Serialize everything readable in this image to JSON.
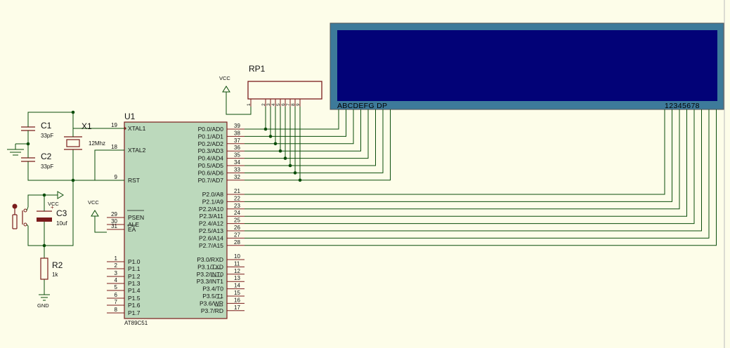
{
  "components": {
    "u1": {
      "ref": "U1",
      "part": "AT89C51",
      "left_pins": [
        {
          "num": "19",
          "name": "XTAL1"
        },
        {
          "num": "18",
          "name": "XTAL2"
        },
        {
          "num": "9",
          "name": "RST"
        },
        {
          "num": "29",
          "name": "PSEN"
        },
        {
          "num": "30",
          "name": "ALE"
        },
        {
          "num": "31",
          "name": "EA"
        },
        {
          "num": "1",
          "name": "P1.0"
        },
        {
          "num": "2",
          "name": "P1.1"
        },
        {
          "num": "3",
          "name": "P1.2"
        },
        {
          "num": "4",
          "name": "P1.3"
        },
        {
          "num": "5",
          "name": "P1.4"
        },
        {
          "num": "6",
          "name": "P1.5"
        },
        {
          "num": "7",
          "name": "P1.6"
        },
        {
          "num": "8",
          "name": "P1.7"
        }
      ],
      "right_pins": [
        {
          "num": "39",
          "name": "P0.0/AD0"
        },
        {
          "num": "38",
          "name": "P0.1/AD1"
        },
        {
          "num": "37",
          "name": "P0.2/AD2"
        },
        {
          "num": "36",
          "name": "P0.3/AD3"
        },
        {
          "num": "35",
          "name": "P0.4/AD4"
        },
        {
          "num": "34",
          "name": "P0.5/AD5"
        },
        {
          "num": "33",
          "name": "P0.6/AD6"
        },
        {
          "num": "32",
          "name": "P0.7/AD7"
        },
        {
          "num": "21",
          "name": "P2.0/A8"
        },
        {
          "num": "22",
          "name": "P2.1/A9"
        },
        {
          "num": "23",
          "name": "P2.2/A10"
        },
        {
          "num": "24",
          "name": "P2.3/A11"
        },
        {
          "num": "25",
          "name": "P2.4/A12"
        },
        {
          "num": "26",
          "name": "P2.5/A13"
        },
        {
          "num": "27",
          "name": "P2.6/A14"
        },
        {
          "num": "28",
          "name": "P2.7/A15"
        },
        {
          "num": "10",
          "name": "P3.0/RXD"
        },
        {
          "num": "11",
          "name": "P3.1/TXD"
        },
        {
          "num": "12",
          "name": "P3.2/INT0"
        },
        {
          "num": "13",
          "name": "P3.3/INT1"
        },
        {
          "num": "14",
          "name": "P3.4/T0"
        },
        {
          "num": "15",
          "name": "P3.5/T1"
        },
        {
          "num": "16",
          "name": "P3.6/WR"
        },
        {
          "num": "17",
          "name": "P3.7/RD"
        }
      ]
    },
    "rp1": {
      "ref": "RP1",
      "pins": [
        "1",
        "2",
        "3",
        "4",
        "5",
        "6",
        "7",
        "8",
        "9"
      ]
    },
    "c1": {
      "ref": "C1",
      "value": "33pF"
    },
    "c2": {
      "ref": "C2",
      "value": "33pF"
    },
    "x1": {
      "ref": "X1",
      "value": "12Mhz"
    },
    "c3": {
      "ref": "C3",
      "value": "10uf"
    },
    "r2": {
      "ref": "R2",
      "value": "1k"
    },
    "display": {
      "segment_label": "ABCDEFG DP",
      "digit_label": "12345678",
      "frame_color": "#3d7a9a",
      "screen_color": "#020277"
    }
  },
  "power": {
    "vcc": "VCC",
    "gnd": "GND"
  },
  "colors": {
    "wire": "#0a4d0a",
    "component": "#7a1c1c",
    "chip_fill": "#bcd9bc",
    "background": "#fdfde9"
  }
}
